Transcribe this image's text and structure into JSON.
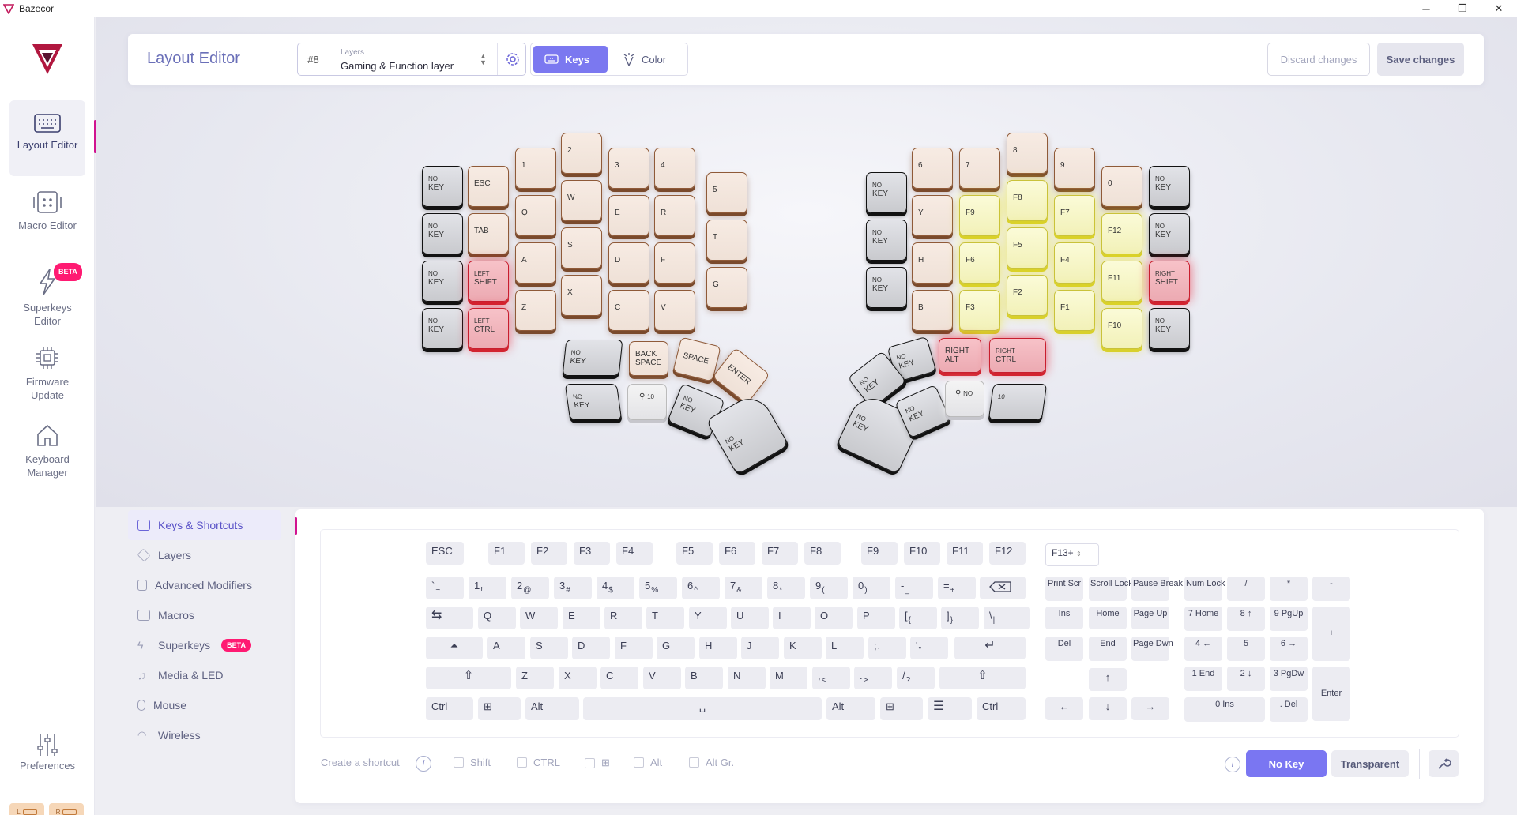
{
  "window": {
    "title": "Bazecor",
    "min": "─",
    "max": "❐",
    "close": "✕"
  },
  "nav": [
    {
      "label": "Layout Editor",
      "icon": "keyboard-icon"
    },
    {
      "label": "Macro Editor",
      "icon": "macro-icon"
    },
    {
      "label": "Superkeys Editor",
      "icon": "lightning-icon",
      "badge": "BETA"
    },
    {
      "label": "Firmware Update",
      "icon": "chip-icon"
    },
    {
      "label": "Keyboard Manager",
      "icon": "home-icon"
    }
  ],
  "preferences": {
    "label": "Preferences"
  },
  "battery": {
    "left": "L",
    "right": "R"
  },
  "header": {
    "title": "Layout Editor",
    "layer_number": "#8",
    "layer_caption": "Layers",
    "layer_value": "Gaming & Function layer",
    "keys_label": "Keys",
    "color_label": "Color",
    "discard_label": "Discard changes",
    "save_label": "Save changes"
  },
  "split_keyboard": {
    "left": [
      [
        "NO",
        "KEY"
      ],
      [
        "NO",
        "KEY"
      ],
      [
        "NO",
        "KEY"
      ],
      [
        "NO",
        "KEY"
      ],
      [
        "ESC"
      ],
      [
        "TAB"
      ],
      [
        "LEFT",
        "SHIFT"
      ],
      [
        "LEFT",
        "CTRL"
      ],
      [
        "1"
      ],
      [
        "Q"
      ],
      [
        "A"
      ],
      [
        "Z"
      ],
      [
        "2"
      ],
      [
        "W"
      ],
      [
        "S"
      ],
      [
        "X"
      ],
      [
        "3"
      ],
      [
        "E"
      ],
      [
        "D"
      ],
      [
        "C"
      ],
      [
        "4"
      ],
      [
        "R"
      ],
      [
        "F"
      ],
      [
        "V"
      ],
      [
        "5"
      ],
      [
        "T"
      ],
      [
        "G"
      ],
      [
        "NO",
        "KEY"
      ],
      [
        "BACK",
        "SPACE"
      ],
      [
        "SPACE"
      ],
      [
        "ENTER"
      ],
      [
        "NO",
        "KEY"
      ],
      [
        "10"
      ],
      [
        "NO",
        "KEY"
      ],
      [
        "NO",
        "KEY"
      ]
    ],
    "right": [
      [
        "NO",
        "KEY"
      ],
      [
        "NO",
        "KEY"
      ],
      [
        "NO",
        "KEY"
      ],
      [
        "6"
      ],
      [
        "Y"
      ],
      [
        "H"
      ],
      [
        "B"
      ],
      [
        "7"
      ],
      [
        "F9"
      ],
      [
        "F6"
      ],
      [
        "F3"
      ],
      [
        "8"
      ],
      [
        "F8"
      ],
      [
        "F5"
      ],
      [
        "F2"
      ],
      [
        "9"
      ],
      [
        "F7"
      ],
      [
        "F4"
      ],
      [
        "F1"
      ],
      [
        "0"
      ],
      [
        "F12"
      ],
      [
        "F11"
      ],
      [
        "F10"
      ],
      [
        "NO",
        "KEY"
      ],
      [
        "NO",
        "KEY"
      ],
      [
        "RIGHT",
        "SHIFT"
      ],
      [
        "NO",
        "KEY"
      ],
      [
        "RIGHT",
        "ALT"
      ],
      [
        "RIGHT",
        "CTRL"
      ],
      [
        "NO",
        "KEY"
      ],
      [
        "NO",
        "KEY"
      ],
      [
        "NO",
        "KEY"
      ],
      [
        "NO",
        "KEY"
      ],
      [
        "10"
      ],
      [
        "NO",
        "KEY"
      ]
    ]
  },
  "categories": [
    {
      "label": "Keys & Shortcuts"
    },
    {
      "label": "Layers"
    },
    {
      "label": "Advanced Modifiers"
    },
    {
      "label": "Macros"
    },
    {
      "label": "Superkeys",
      "badge": "BETA"
    },
    {
      "label": "Media & LED"
    },
    {
      "label": "Mouse"
    },
    {
      "label": "Wireless"
    }
  ],
  "virtual_keyboard": {
    "fn_row": [
      "ESC",
      "F1",
      "F2",
      "F3",
      "F4",
      "F5",
      "F6",
      "F7",
      "F8",
      "F9",
      "F10",
      "F11",
      "F12"
    ],
    "f13_select": "F13+",
    "num_row": [
      "`",
      "1",
      "2",
      "3",
      "4",
      "5",
      "6",
      "7",
      "8",
      "9",
      "0",
      "-",
      "="
    ],
    "num_row_shift": [
      "~",
      "!",
      "@",
      "#",
      "$",
      "%",
      "^",
      "&",
      "*",
      "(",
      ")",
      "_",
      "+"
    ],
    "q_row": [
      "Q",
      "W",
      "E",
      "R",
      "T",
      "Y",
      "U",
      "I",
      "O",
      "P",
      "[",
      "]",
      "\\"
    ],
    "q_row_shift": [
      "",
      "",
      "",
      "",
      "",
      "",
      "",
      "",
      "",
      "",
      "{",
      "}",
      "|"
    ],
    "a_row": [
      "A",
      "S",
      "D",
      "F",
      "G",
      "H",
      "J",
      "K",
      "L",
      ";",
      "'"
    ],
    "a_row_shift": [
      "",
      "",
      "",
      "",
      "",
      "",
      "",
      "",
      "",
      ":",
      "\""
    ],
    "z_row": [
      "Z",
      "X",
      "C",
      "V",
      "B",
      "N",
      "M",
      ",",
      ".",
      "/"
    ],
    "z_row_shift": [
      "",
      "",
      "",
      "",
      "",
      "",
      "",
      "<",
      ">",
      "?"
    ],
    "bottom_row": {
      "ctrl": "Ctrl",
      "alt": "Alt",
      "altgr": "Alt",
      "rctrl": "Ctrl"
    },
    "nav_cluster": [
      "Print Scr",
      "Scroll Lock",
      "Pause Break",
      "Ins",
      "Home",
      "Page Up",
      "Del",
      "End",
      "Page Dwn"
    ],
    "numpad": [
      "Num Lock",
      "/",
      "*",
      "-",
      "7 Home",
      "8 ↑",
      "9 PgUp",
      "+",
      "4 ←",
      "5",
      "6 →",
      "1 End",
      "2 ↓",
      "3 PgDw",
      "Enter",
      "0 Ins",
      ". Del"
    ]
  },
  "footer": {
    "create_shortcut": "Create a shortcut",
    "shift": "Shift",
    "ctrl": "CTRL",
    "alt": "Alt",
    "altgr": "Alt Gr.",
    "no_key": "No Key",
    "transparent": "Transparent"
  },
  "colors": {
    "accent": "#7b78f0",
    "brand_pink": "#d1138f",
    "red_key": "#e8323f",
    "yellow_key": "#e8e02a",
    "brown_key": "#8f5a38"
  }
}
